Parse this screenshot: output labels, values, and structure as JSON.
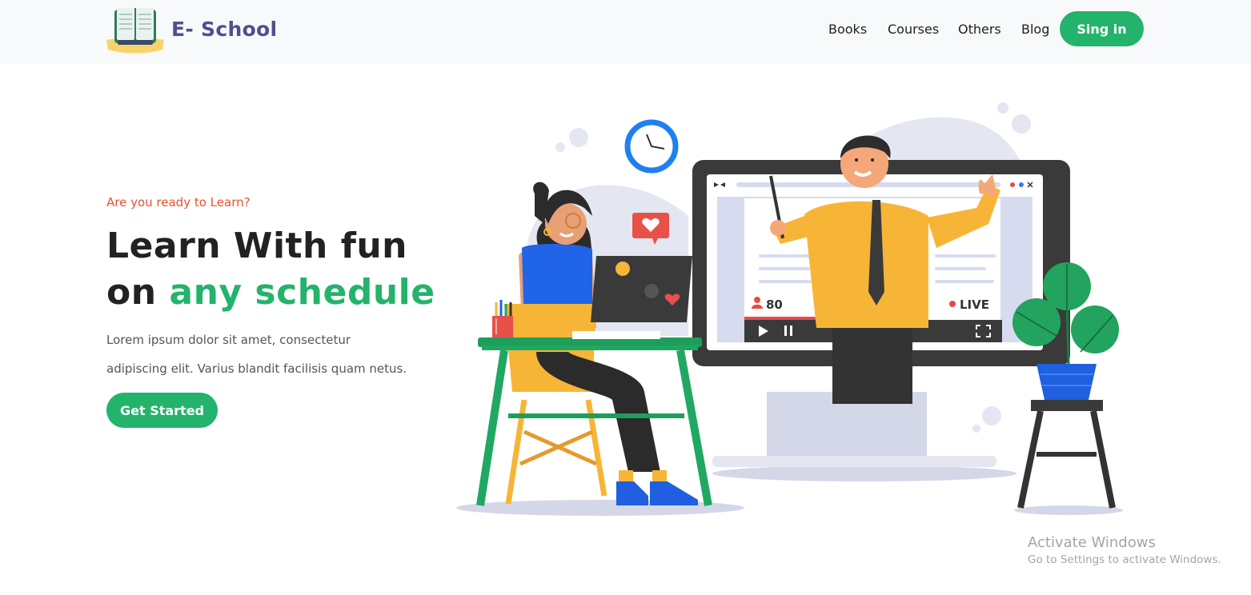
{
  "brand": {
    "name": "E- School",
    "logo_icon": "open-book-icon"
  },
  "nav": {
    "items": [
      {
        "label": "Books"
      },
      {
        "label": "Courses"
      },
      {
        "label": "Others"
      },
      {
        "label": "Blog"
      }
    ],
    "signin_label": "Sing in"
  },
  "hero": {
    "kicker": "Are you ready to Learn?",
    "headline_line1": "Learn With fun",
    "headline_line2_prefix": "on",
    "headline_line2_accent": "any schedule",
    "description": "Lorem ipsum dolor sit amet, consectetur adipiscing elit. Varius blandit facilisis quam netus.",
    "cta_label": "Get Started"
  },
  "illustration": {
    "viewer_count": "80",
    "live_label": "LIVE",
    "icons": [
      "clock-icon",
      "heart-chat-icon",
      "play-icon",
      "pause-icon",
      "fullscreen-icon",
      "user-icon",
      "live-dot-icon"
    ]
  },
  "watermark": {
    "title": "Activate Windows",
    "subtitle": "Go to Settings to activate Windows."
  },
  "colors": {
    "accent": "#24b36b",
    "kicker": "#e8512f",
    "brand_text": "#4e4f8f",
    "navbar_bg": "#f8f9fa",
    "heading": "#222222"
  }
}
